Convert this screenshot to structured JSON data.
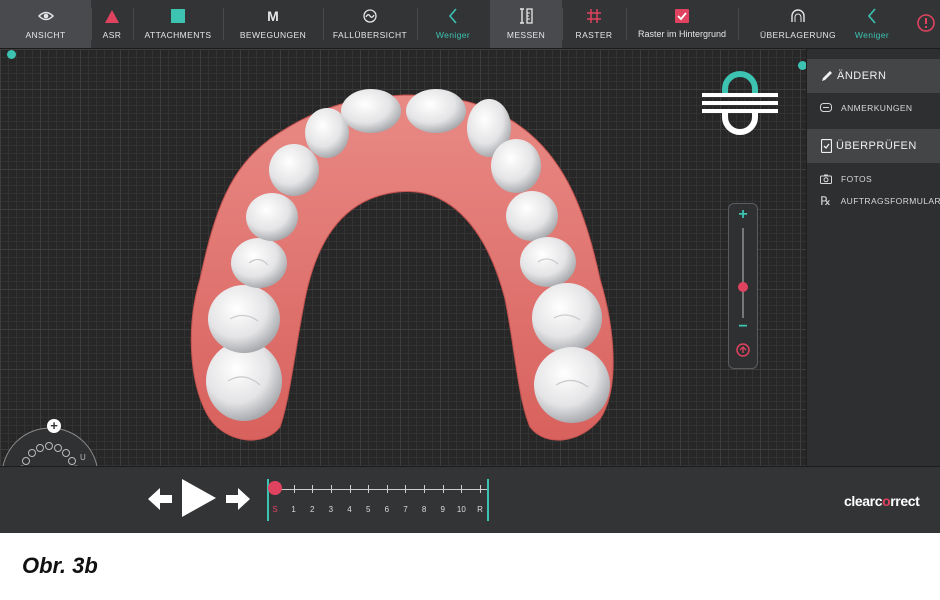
{
  "toolbar": {
    "items": [
      {
        "label": "ANSICHT",
        "icon": "eye-icon"
      },
      {
        "label": "ASR",
        "icon": "triangle-icon"
      },
      {
        "label": "ATTACHMENTS",
        "icon": "square-icon"
      },
      {
        "label": "BEWEGUNGEN",
        "icon": "letter-m-icon",
        "glyph": "M"
      },
      {
        "label": "FALLÜBERSICHT",
        "icon": "overview-icon"
      },
      {
        "label": "Weniger",
        "icon": "chevron-left-icon"
      },
      {
        "label": "MESSEN",
        "icon": "measure-icon"
      },
      {
        "label": "RASTER",
        "icon": "grid-icon"
      },
      {
        "label": "Raster im Hintergrund",
        "icon": "checkbox-checked-icon"
      },
      {
        "label": "ÜBERLAGERUNG",
        "icon": "arch-overlay-icon"
      },
      {
        "label": "Weniger",
        "icon": "chevron-left-icon"
      }
    ],
    "info_icon": "info-icon"
  },
  "right_panel": {
    "section1": {
      "title": "ÄNDERN",
      "icon": "pencil-icon"
    },
    "anmerkungen": {
      "label": "ANMERKUNGEN",
      "icon": "comment-icon"
    },
    "section2": {
      "title": "ÜBERPRÜFEN",
      "icon": "checklist-icon"
    },
    "fotos": {
      "label": "FOTOS",
      "icon": "camera-icon"
    },
    "auftrag": {
      "label": "AUFTRAGSFORMULAR",
      "icon": "rx-icon",
      "glyph": "℞"
    }
  },
  "zoom": {
    "plus": "+",
    "minus": "−",
    "level": 0.35
  },
  "minimap": {
    "label_u": "U",
    "label_l": "L",
    "plus": "+"
  },
  "timeline": {
    "labels": [
      "S",
      "1",
      "2",
      "3",
      "4",
      "5",
      "6",
      "7",
      "8",
      "9",
      "10",
      "R"
    ],
    "current": "S"
  },
  "brand": {
    "prefix": "clearc",
    "highlight": "o",
    "suffix": "rrect"
  },
  "caption": "Obr. 3b",
  "colors": {
    "accent": "#3cc3b2",
    "alert": "#e0435f",
    "gum": "#e2706c",
    "background": "#272727"
  }
}
